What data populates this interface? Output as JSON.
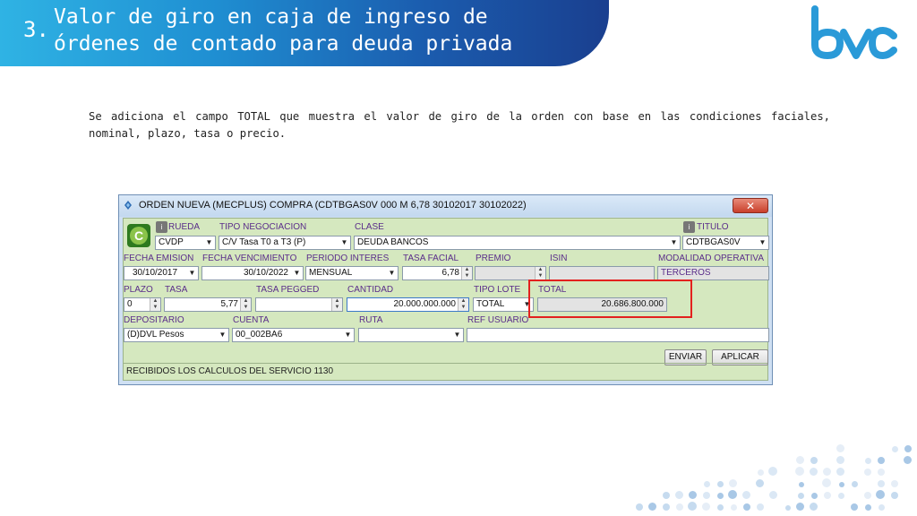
{
  "slide": {
    "number": "3.",
    "title_line1": "Valor de giro en caja de ingreso de",
    "title_line2": "órdenes de contado para deuda privada",
    "description": "Se adiciona el campo TOTAL que muestra el valor de giro de la orden con base en las condiciones faciales, nominal, plazo, tasa o precio.",
    "logo_text": "bvc",
    "colors": {
      "header_start": "#2fb3e4",
      "header_end": "#1a3f8f",
      "logo": "#2a9ad8"
    }
  },
  "window": {
    "title": "ORDEN NUEVA (MECPLUS) COMPRA (CDTBGAS0V 000 M 6,78 30102017 30102022)",
    "close_label": "✕",
    "green_icon_label": "C",
    "info_icon_label": "i",
    "labels": {
      "rueda": "RUEDA",
      "tipo_negociacion": "TIPO NEGOCIACION",
      "clase": "CLASE",
      "titulo": "TITULO",
      "fecha_emision": "FECHA EMISION",
      "fecha_vencimiento": "FECHA VENCIMIENTO",
      "periodo_interes": "PERIODO INTERES",
      "tasa_facial": "TASA FACIAL",
      "premio": "PREMIO",
      "isin": "ISIN",
      "modalidad_operativa": "MODALIDAD OPERATIVA",
      "plazo": "PLAZO",
      "tasa": "TASA",
      "tasa_pegged": "TASA PEGGED",
      "cantidad": "CANTIDAD",
      "tipo_lote": "TIPO LOTE",
      "total": "TOTAL",
      "depositario": "DEPOSITARIO",
      "cuenta": "CUENTA",
      "ruta": "RUTA",
      "ref_usuario": "REF USUARIO"
    },
    "values": {
      "rueda": "CVDP",
      "tipo_negociacion": "C/V Tasa T0 a T3 (P)",
      "clase": "DEUDA BANCOS",
      "titulo": "CDTBGAS0V",
      "fecha_emision": "30/10/2017",
      "fecha_vencimiento": "30/10/2022",
      "periodo_interes": "MENSUAL",
      "tasa_facial": "6,78",
      "premio": "",
      "isin": "",
      "modalidad_operativa": "TERCEROS",
      "plazo": "0",
      "tasa": "5,77",
      "tasa_pegged": "",
      "cantidad": "20.000.000.000",
      "tipo_lote": "TOTAL",
      "total": "20.686.800.000",
      "depositario": "(D)DVL Pesos",
      "cuenta": "00_002BA6",
      "ruta": "",
      "ref_usuario": ""
    },
    "buttons": {
      "enviar": "ENVIAR",
      "aplicar": "APLICAR"
    },
    "status": "RECIBIDOS LOS CALCULOS DEL SERVICIO 1130"
  }
}
